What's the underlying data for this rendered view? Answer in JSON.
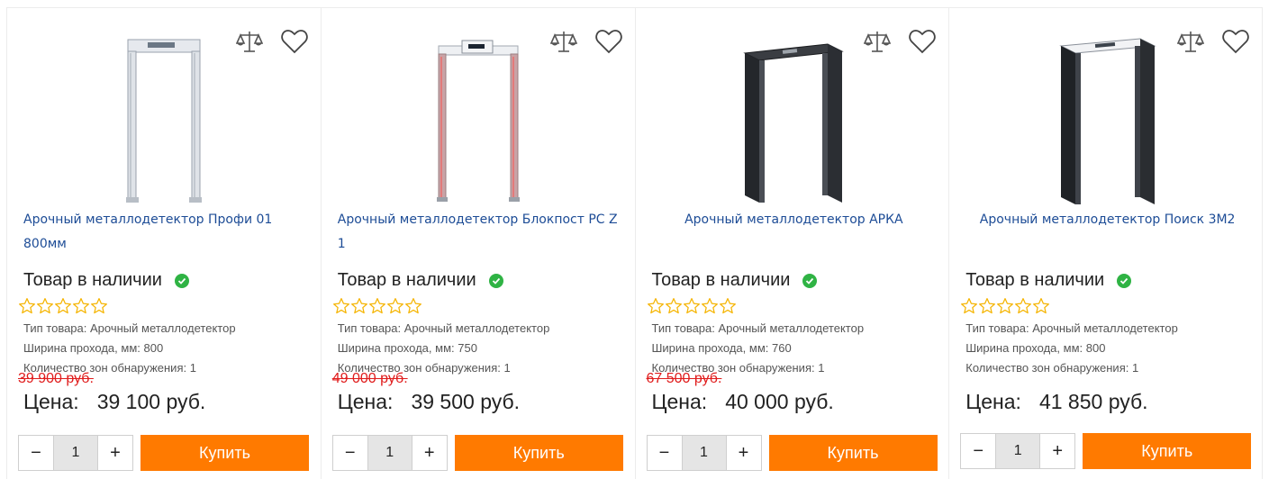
{
  "products": [
    {
      "title": "Арочный металлодетектор Профи 01 800мм",
      "title_center": false,
      "stock": "Товар в наличии",
      "props": [
        "Тип товара: Арочный металлодетектор",
        "Ширина прохода, мм: 800",
        "Количество зон обнаружения: 1"
      ],
      "old_price": "39 900 руб.",
      "price_label": "Цена:",
      "price": "39 100 руб.",
      "qty": "1",
      "buy_label": "Купить",
      "image_style": "light"
    },
    {
      "title": "Арочный металлодетектор Блокпост PC Z 1",
      "title_center": false,
      "stock": "Товар в наличии",
      "props": [
        "Тип товара: Арочный металлодетектор",
        "Ширина прохода, мм: 750",
        "Количество зон обнаружения: 1"
      ],
      "old_price": "49 000 руб.",
      "price_label": "Цена:",
      "price": "39 500 руб.",
      "qty": "1",
      "buy_label": "Купить",
      "image_style": "red"
    },
    {
      "title": "Арочный металлодетектор АРКА",
      "title_center": true,
      "stock": "Товар в наличии",
      "props": [
        "Тип товара: Арочный металлодетектор",
        "Ширина прохода, мм: 760",
        "Количество зон обнаружения: 1"
      ],
      "old_price": "67 500 руб.",
      "price_label": "Цена:",
      "price": "40 000 руб.",
      "qty": "1",
      "buy_label": "Купить",
      "image_style": "dark"
    },
    {
      "title": "Арочный металлодетектор Поиск 3М2",
      "title_center": true,
      "stock": "Товар в наличии",
      "props": [
        "Тип товара: Арочный металлодетектор",
        "Ширина прохода, мм: 800",
        "Количество зон обнаружения: 1"
      ],
      "old_price": "",
      "price_label": "Цена:",
      "price": "41 850 руб.",
      "qty": "1",
      "buy_label": "Купить",
      "image_style": "black"
    }
  ],
  "qty_minus": "−",
  "qty_plus": "+",
  "icons": {
    "compare": "scales-icon",
    "favorite": "heart-icon",
    "in_stock": "check-circle-icon",
    "star": "star-outline-icon"
  },
  "colors": {
    "accent": "#ff7a00",
    "title_link": "#1d4c96",
    "old_price": "#e01c1c",
    "in_stock": "#2fb344",
    "star": "#f5b400"
  },
  "rating_stars": 5
}
